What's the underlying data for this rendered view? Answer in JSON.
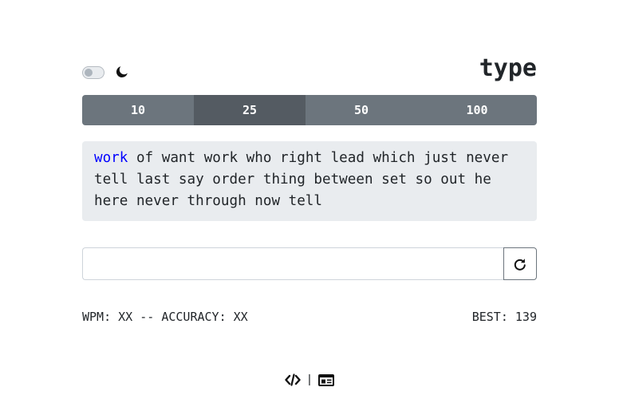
{
  "header": {
    "title": "type",
    "theme_toggle_icon": "theme-toggle-switch",
    "moon_icon": "moon-icon"
  },
  "modes": [
    {
      "label": "10",
      "active": false
    },
    {
      "label": "25",
      "active": true
    },
    {
      "label": "50",
      "active": false
    },
    {
      "label": "100",
      "active": false
    }
  ],
  "text": {
    "current_word": "work",
    "remaining": " of want work who right lead which just never tell last say order thing between set so out he here never through now tell"
  },
  "input": {
    "value": "",
    "placeholder": ""
  },
  "redo_icon": "redo-icon",
  "stats": {
    "left": "WPM: XX -- ACCURACY: XX",
    "best": "BEST: 139"
  },
  "footer": {
    "code_icon": "code-icon",
    "separator": "|",
    "profile_icon": "id-card-icon"
  },
  "colors": {
    "mode_bg": "#6c757d",
    "mode_active_bg": "#545b62",
    "text_box_bg": "#e9ecef",
    "current_word": "#0000ff"
  }
}
